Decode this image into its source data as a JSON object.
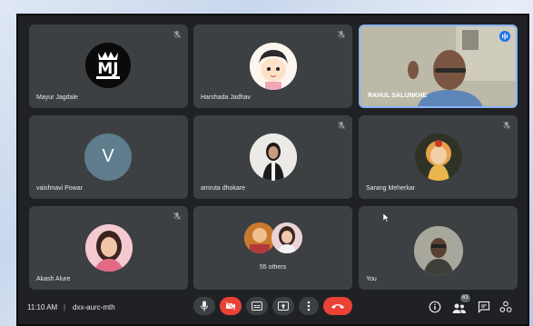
{
  "participants": [
    {
      "name": "Mayur Jagdale",
      "initials": "MJ"
    },
    {
      "name": "Harshada Jadhav"
    },
    {
      "name": "RAHUL SALUNKHE"
    },
    {
      "name": "vaishnavi Powar",
      "initial": "V"
    },
    {
      "name": "amruta dhokare"
    },
    {
      "name": "Sarang Meherkar"
    },
    {
      "name": "Akash Alure"
    },
    {
      "name": "You"
    }
  ],
  "others": {
    "label": "55 others"
  },
  "bottom_bar": {
    "time": "11:10 AM",
    "separator": "|",
    "meeting_code": "dxx-aurc-mth",
    "participant_count": "63"
  },
  "icons": [
    "mic-icon",
    "camera-off-icon",
    "captions-icon",
    "present-icon",
    "more-icon",
    "hangup-icon",
    "info-icon",
    "people-icon",
    "chat-icon",
    "activities-icon",
    "mic-off-icon",
    "speaking-icon"
  ],
  "colors": {
    "background": "#202124",
    "tile": "#3c4043",
    "hangup": "#ea4335",
    "active_speaker": "#8ab4f8",
    "initial_avatar": "#5f7d8c"
  }
}
